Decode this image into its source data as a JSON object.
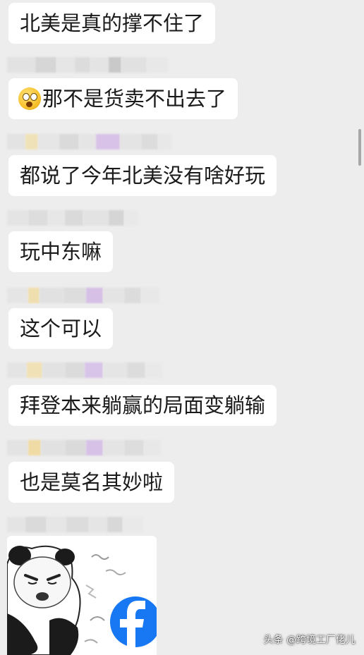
{
  "messages": [
    {
      "text": "北美是真的撑不住了",
      "emoji": null
    },
    {
      "text": "那不是货卖不出去了",
      "emoji": "astonished-face-icon"
    },
    {
      "text": "都说了今年北美没有啥好玩",
      "emoji": null
    },
    {
      "text": "玩中东嘛",
      "emoji": null
    },
    {
      "text": "这个可以",
      "emoji": null
    },
    {
      "text": "拜登本来躺赢的局面变躺输",
      "emoji": null
    },
    {
      "text": "也是莫名其妙啦",
      "emoji": null
    }
  ],
  "sticker": {
    "description_icon": "panda-meme-sticker-icon",
    "logo_letter": "f",
    "logo_color": "#1877f2"
  },
  "watermark": "头条 @跨境工厂佬儿",
  "colors": {
    "background": "#ededed",
    "bubble": "#ffffff",
    "text": "#1a1a1a"
  }
}
